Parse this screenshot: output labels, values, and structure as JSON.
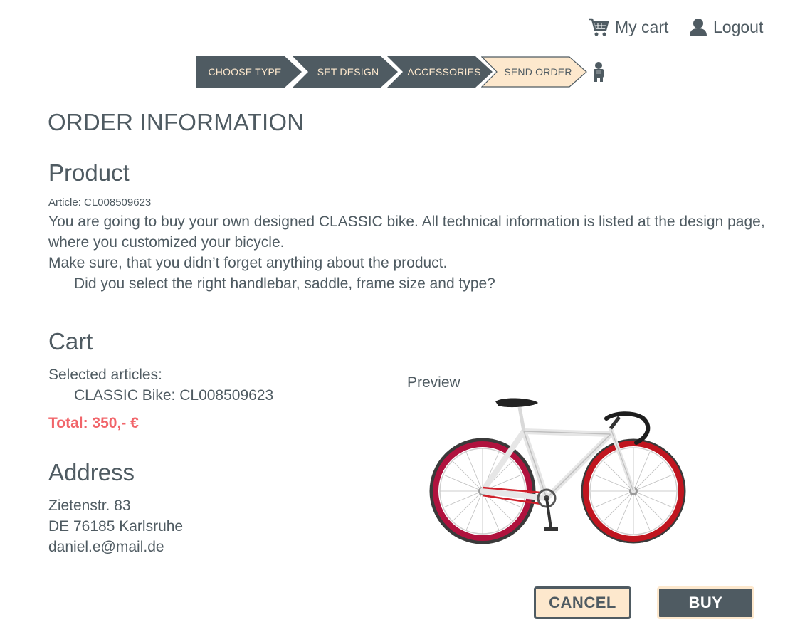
{
  "header": {
    "cart_label": "My cart",
    "logout_label": "Logout"
  },
  "steps": [
    {
      "label": "CHOOSE TYPE",
      "state": "done"
    },
    {
      "label": "SET DESIGN",
      "state": "done"
    },
    {
      "label": "ACCESSORIES",
      "state": "done"
    },
    {
      "label": "SEND ORDER",
      "state": "active"
    }
  ],
  "page": {
    "title": "ORDER INFORMATION"
  },
  "product": {
    "heading": "Product",
    "article": "Article: CL008509623",
    "line1": "You are going to buy your own designed CLASSIC bike. All technical information is listed at the design page, where you customized your bicycle.",
    "line2": "Make sure, that you didn’t forget anything about the product.",
    "line3": "Did you select the right handlebar, saddle, frame size and type?"
  },
  "cart": {
    "heading": "Cart",
    "selected_label": "Selected articles:",
    "item": "CLASSIC Bike: CL008509623",
    "total": "Total: 350,- €"
  },
  "address": {
    "heading": "Address",
    "street": "Zietenstr. 83",
    "city": "DE 76185 Karlsruhe",
    "email": "daniel.e@mail.de"
  },
  "preview": {
    "label": "Preview"
  },
  "actions": {
    "cancel_label": "CANCEL",
    "buy_label": "BUY"
  },
  "colors": {
    "dark": "#4f5b62",
    "cream": "#fde8cd",
    "accent_red": "#f1656a",
    "rim_red": "#c0151f"
  },
  "icons": [
    "cart-icon",
    "user-icon",
    "person-step-icon"
  ]
}
